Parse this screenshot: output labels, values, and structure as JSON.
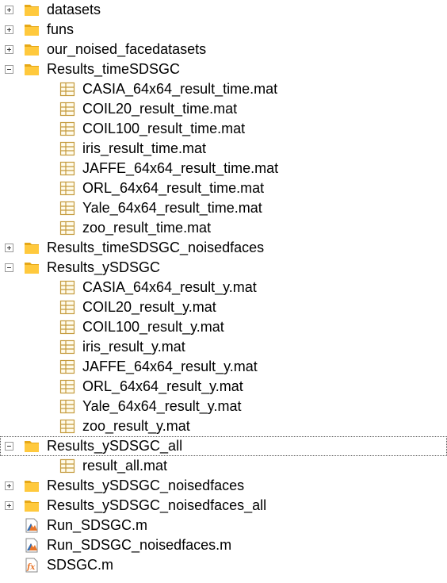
{
  "tree": [
    {
      "label": "datasets",
      "type": "folder",
      "level": 0,
      "state": "collapsed"
    },
    {
      "label": "funs",
      "type": "folder",
      "level": 0,
      "state": "collapsed"
    },
    {
      "label": "our_noised_facedatasets",
      "type": "folder",
      "level": 0,
      "state": "collapsed"
    },
    {
      "label": "Results_timeSDSGC",
      "type": "folder",
      "level": 0,
      "state": "expanded"
    },
    {
      "label": "CASIA_64x64_result_time.mat",
      "type": "mat",
      "level": 1
    },
    {
      "label": "COIL20_result_time.mat",
      "type": "mat",
      "level": 1
    },
    {
      "label": "COIL100_result_time.mat",
      "type": "mat",
      "level": 1
    },
    {
      "label": "iris_result_time.mat",
      "type": "mat",
      "level": 1
    },
    {
      "label": "JAFFE_64x64_result_time.mat",
      "type": "mat",
      "level": 1
    },
    {
      "label": "ORL_64x64_result_time.mat",
      "type": "mat",
      "level": 1
    },
    {
      "label": "Yale_64x64_result_time.mat",
      "type": "mat",
      "level": 1
    },
    {
      "label": "zoo_result_time.mat",
      "type": "mat",
      "level": 1
    },
    {
      "label": "Results_timeSDSGC_noisedfaces",
      "type": "folder",
      "level": 0,
      "state": "collapsed"
    },
    {
      "label": "Results_ySDSGC",
      "type": "folder",
      "level": 0,
      "state": "expanded"
    },
    {
      "label": "CASIA_64x64_result_y.mat",
      "type": "mat",
      "level": 1
    },
    {
      "label": "COIL20_result_y.mat",
      "type": "mat",
      "level": 1
    },
    {
      "label": "COIL100_result_y.mat",
      "type": "mat",
      "level": 1
    },
    {
      "label": "iris_result_y.mat",
      "type": "mat",
      "level": 1
    },
    {
      "label": "JAFFE_64x64_result_y.mat",
      "type": "mat",
      "level": 1
    },
    {
      "label": "ORL_64x64_result_y.mat",
      "type": "mat",
      "level": 1
    },
    {
      "label": "Yale_64x64_result_y.mat",
      "type": "mat",
      "level": 1
    },
    {
      "label": "zoo_result_y.mat",
      "type": "mat",
      "level": 1
    },
    {
      "label": "Results_ySDSGC_all",
      "type": "folder",
      "level": 0,
      "state": "expanded",
      "focused": true
    },
    {
      "label": "result_all.mat",
      "type": "mat",
      "level": 1
    },
    {
      "label": "Results_ySDSGC_noisedfaces",
      "type": "folder",
      "level": 0,
      "state": "collapsed"
    },
    {
      "label": "Results_ySDSGC_noisedfaces_all",
      "type": "folder",
      "level": 0,
      "state": "collapsed"
    },
    {
      "label": "Run_SDSGC.m",
      "type": "script",
      "level": 0
    },
    {
      "label": "Run_SDSGC_noisedfaces.m",
      "type": "script",
      "level": 0
    },
    {
      "label": "SDSGC.m",
      "type": "function",
      "level": 0
    }
  ],
  "colors": {
    "folder": "#ffc93d",
    "folder_dark": "#e6a817",
    "mat_grid": "#c49a3c",
    "mat_fill": "#fffbea",
    "script_orange": "#e8762b",
    "script_blue": "#2f6fb8"
  }
}
